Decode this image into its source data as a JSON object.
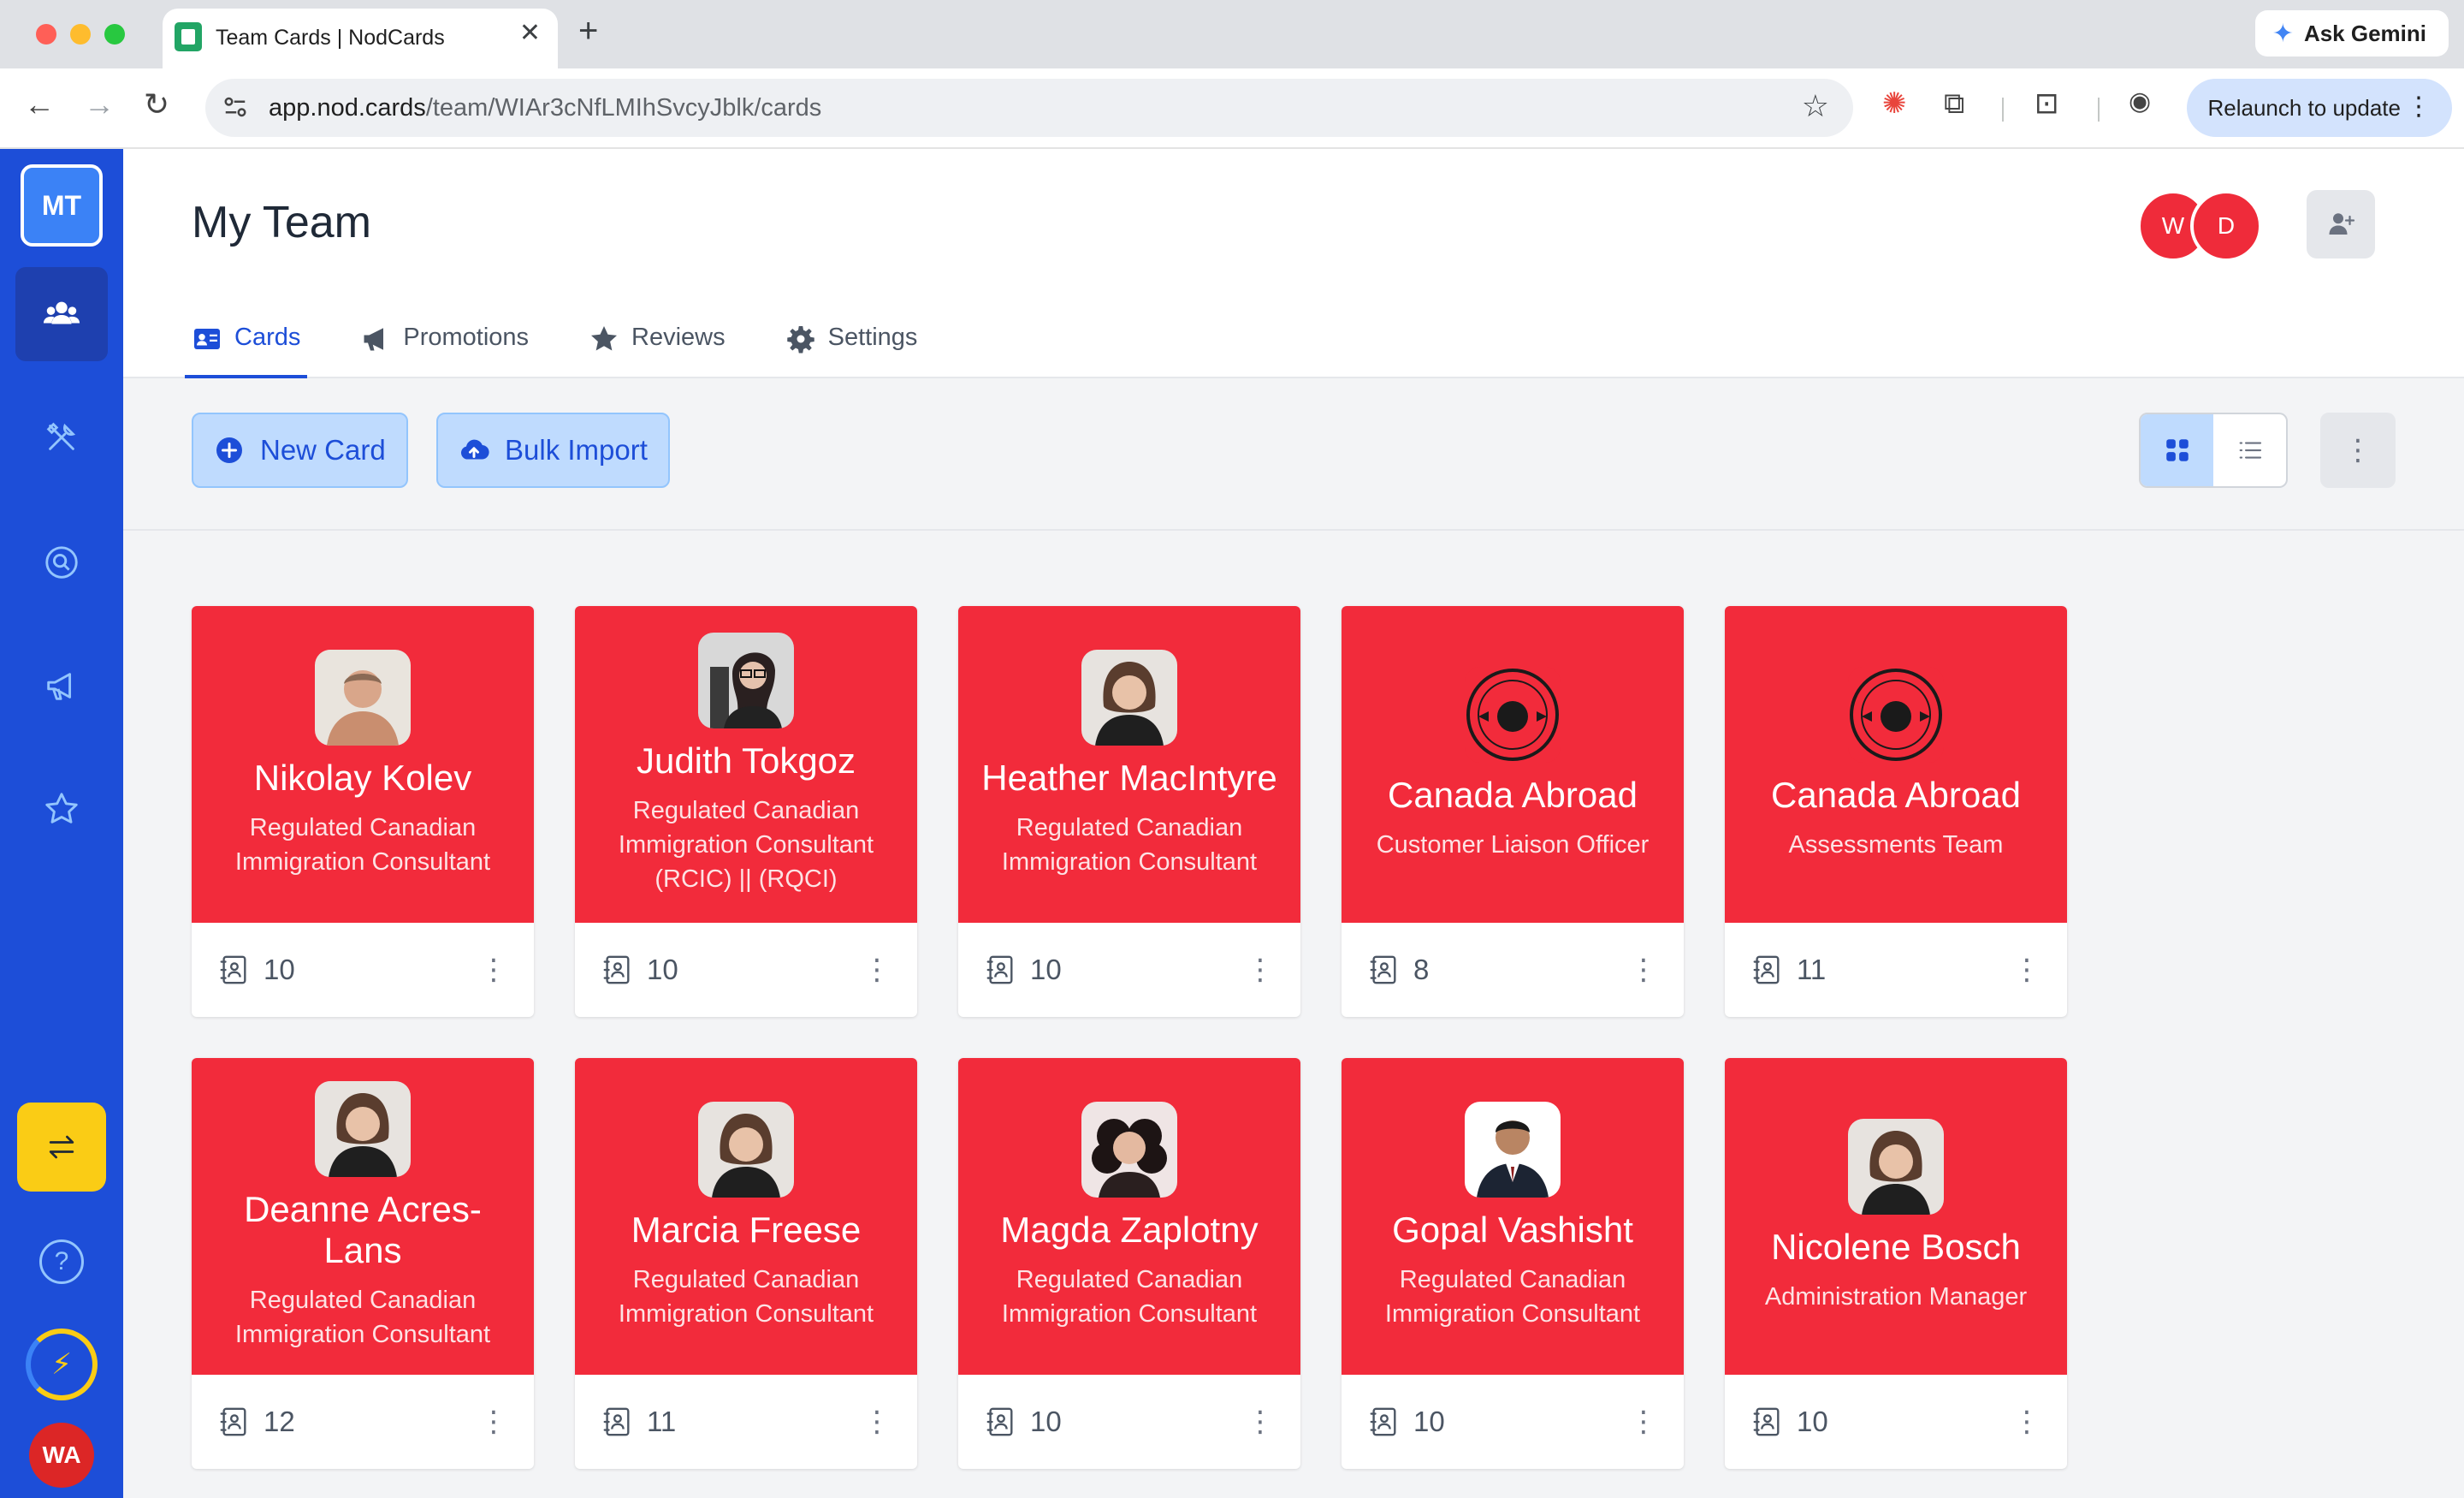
{
  "browser": {
    "tab_title": "Team Cards | NodCards",
    "tab_close": "✕",
    "new_tab": "+",
    "url_host": "app.nod.cards",
    "url_path": "/team/WIAr3cNfLMIhSvcyJblk/cards",
    "ask_gemini": "Ask Gemini",
    "relaunch": "Relaunch to update"
  },
  "sidebar": {
    "logo": "MT",
    "help": "?",
    "user_initials": "WA"
  },
  "header": {
    "title": "My Team",
    "members": [
      "W",
      "D"
    ]
  },
  "tabs": [
    {
      "label": "Cards",
      "active": true
    },
    {
      "label": "Promotions",
      "active": false
    },
    {
      "label": "Reviews",
      "active": false
    },
    {
      "label": "Settings",
      "active": false
    }
  ],
  "actions": {
    "new_card": "New Card",
    "bulk_import": "Bulk Import",
    "view_mode": "grid"
  },
  "colors": {
    "card_accent": "#f22b3b",
    "sidebar": "#1d4ed8",
    "primary": "#1d4ed8"
  },
  "cards": [
    {
      "name": "Nikolay Kolev",
      "role": "Regulated Canadian Immigration Consultant",
      "count": "10",
      "photo": "man-portrait"
    },
    {
      "name": "Judith Tokgoz",
      "role": "Regulated Canadian Immigration Consultant (RCIC) || (RQCI)",
      "count": "10",
      "photo": "woman-glasses-portrait"
    },
    {
      "name": "Heather MacIntyre",
      "role": "Regulated Canadian Immigration Consultant",
      "count": "10",
      "photo": "woman-portrait"
    },
    {
      "name": "Canada Abroad",
      "role": "Customer Liaison Officer",
      "count": "8",
      "photo": "canada-abroad-logo"
    },
    {
      "name": "Canada Abroad",
      "role": "Assessments Team",
      "count": "11",
      "photo": "canada-abroad-logo"
    },
    {
      "name": "Deanne Acres-Lans",
      "role": "Regulated Canadian Immigration Consultant",
      "count": "12",
      "photo": "woman-portrait"
    },
    {
      "name": "Marcia Freese",
      "role": "Regulated Canadian Immigration Consultant",
      "count": "11",
      "photo": "woman-portrait"
    },
    {
      "name": "Magda Zaplotny",
      "role": "Regulated Canadian Immigration Consultant",
      "count": "10",
      "photo": "woman-curly-portrait"
    },
    {
      "name": "Gopal Vashisht",
      "role": "Regulated Canadian Immigration Consultant",
      "count": "10",
      "photo": "man-suit-portrait"
    },
    {
      "name": "Nicolene Bosch",
      "role": "Administration Manager",
      "count": "10",
      "photo": "woman-portrait"
    }
  ]
}
